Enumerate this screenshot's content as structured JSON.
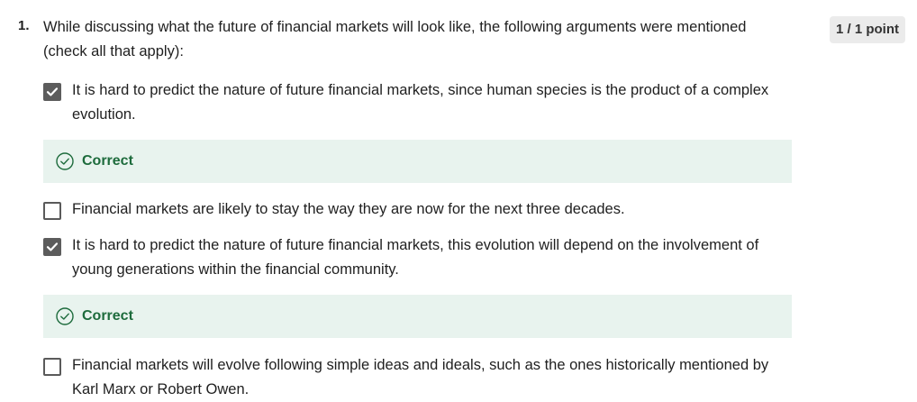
{
  "question": {
    "number": "1.",
    "text": "While discussing what the future of financial markets will look like, the following arguments were mentioned (check all that apply):",
    "points": "1 / 1 point"
  },
  "options": [
    {
      "text": " It is hard to predict the nature of future financial markets, since human species is the product of a complex evolution.",
      "checked": true
    },
    {
      "text": "Financial markets are likely to stay the way they are now for the next three decades.",
      "checked": false
    },
    {
      "text": "It is hard to predict the nature of future financial markets, this evolution will depend on the involvement of young generations within the financial community.",
      "checked": true
    },
    {
      "text": "Financial markets will evolve following simple ideas and ideals, such as the ones historically mentioned by Karl Marx or Robert Owen.",
      "checked": false
    }
  ],
  "feedback": [
    {
      "label": "Correct",
      "icon": "check-circle-icon",
      "color": "#1d6b3c"
    },
    {
      "label": "Correct",
      "icon": "check-circle-icon",
      "color": "#1d6b3c"
    }
  ]
}
